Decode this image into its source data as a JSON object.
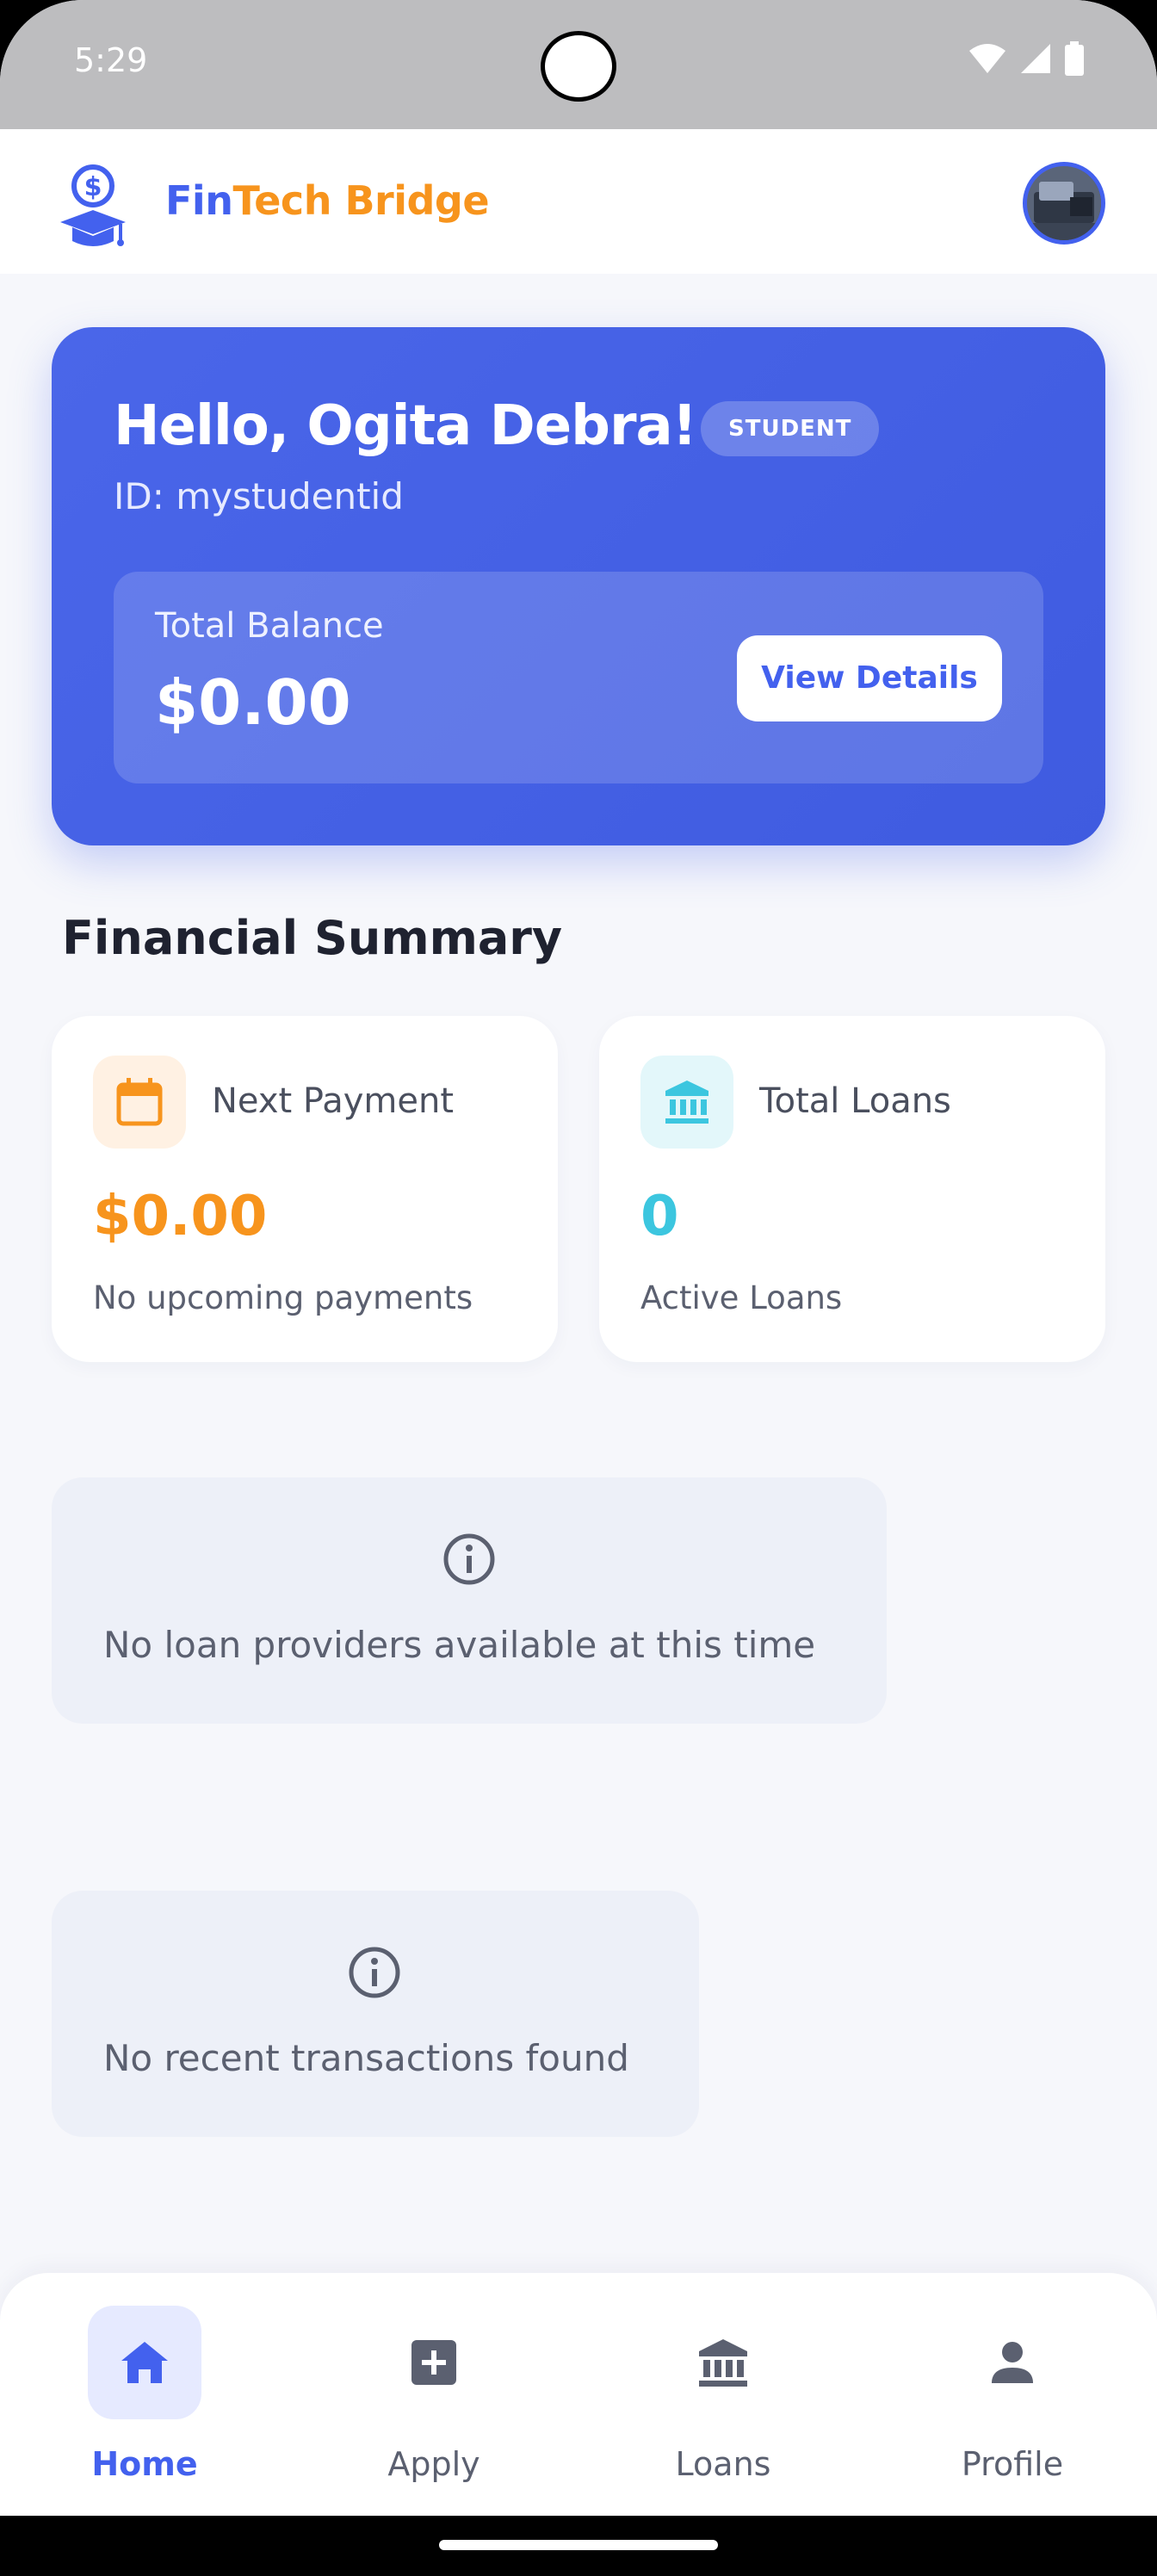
{
  "status_bar": {
    "time": "5:29"
  },
  "app_bar": {
    "brand_part1": "Fin",
    "brand_part2": "Tech Bridge",
    "colors": {
      "primary": "#4361EE",
      "accent": "#F7941D"
    }
  },
  "hero": {
    "greeting": "Hello, Ogita Debra!",
    "badge": "STUDENT",
    "id_text": "ID: mystudentid",
    "balance_label": "Total Balance",
    "balance_value": "$0.00",
    "view_details_label": "View Details"
  },
  "financial_summary": {
    "title": "Financial Summary",
    "cards": [
      {
        "icon": "calendar-icon",
        "label": "Next Payment",
        "value": "$0.00",
        "sub": "No upcoming payments",
        "color": "#F7941D"
      },
      {
        "icon": "bank-icon",
        "label": "Total Loans",
        "value": "0",
        "sub": "Active Loans",
        "color": "#3CC6DF"
      }
    ]
  },
  "empty_states": {
    "providers": "No loan providers available at this time",
    "transactions": "No recent transactions found"
  },
  "bottom_nav": {
    "items": [
      {
        "label": "Home",
        "icon": "home-icon",
        "active": true
      },
      {
        "label": "Apply",
        "icon": "add-box-icon",
        "active": false
      },
      {
        "label": "Loans",
        "icon": "bank-icon",
        "active": false
      },
      {
        "label": "Profile",
        "icon": "person-icon",
        "active": false
      }
    ]
  }
}
